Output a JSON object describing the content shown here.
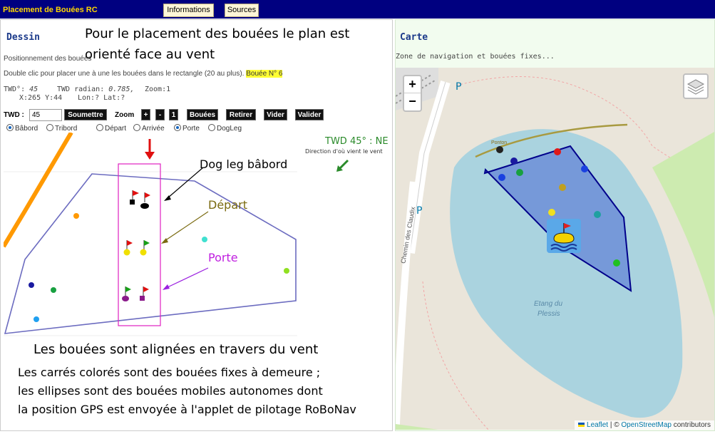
{
  "app": {
    "title": "Placement de Bouées RC"
  },
  "top_buttons": [
    "Informations",
    "Sources"
  ],
  "left": {
    "title": "Dessin",
    "desc1": "Positionnement des bouées ",
    "desc2": "Double clic pour placer une à une les bouées dans le rectangle (20 au plus).",
    "buoy_highlight": "Bouée N° 6",
    "twd_deg_label": "TWD°:",
    "twd_deg_value": "45",
    "twd_rad_label": "TWD radian:",
    "twd_rad_value": "0.785,",
    "zoom_info": "Zoom:1",
    "xy_info": "X:265 Y:44",
    "lonlat_info": "Lon:? Lat:?",
    "twd_label": "TWD :",
    "twd_input_value": "45",
    "submit_label": "Soumettre",
    "zoom_label": "Zoom",
    "zoom_plus": "+",
    "zoom_minus": "-",
    "zoom_value": "1",
    "btn_bouees": "Bouées",
    "btn_retirer": "Retirer",
    "btn_vider": "Vider",
    "btn_valider": "Valider",
    "radios": [
      {
        "label": "Bâbord",
        "checked": true
      },
      {
        "label": "Tribord",
        "checked": false
      },
      {
        "label": "Départ",
        "checked": false
      },
      {
        "label": "Arrivée",
        "checked": false
      },
      {
        "label": "Porte",
        "checked": true
      },
      {
        "label": "DogLeg",
        "checked": false
      }
    ]
  },
  "wind": {
    "title": "TWD 45° : NE",
    "subtitle": "Direction d'où vient le vent"
  },
  "annotations": {
    "header_line1": "Pour le placement des bouées le plan est",
    "header_line2": "orienté face au vent",
    "dogleg": "Dog leg bâbord",
    "depart": "Départ",
    "porte": "Porte",
    "aligned": "Les bouées sont alignées en travers du vent",
    "note1": "Les carrés colorés sont des bouées fixes à demeure ;",
    "note2": "les ellipses sont des bouées mobiles autonomes dont",
    "note3": "la position GPS est envoyée à l'applet de pilotage RoBoNav"
  },
  "right": {
    "title": "Carte",
    "subtitle": "Zone de navigation et bouées fixes...",
    "map": {
      "zoom_in": "+",
      "zoom_out": "−",
      "label_parking1": "P",
      "label_parking2": "P",
      "label_road": "Chemin des Claudix",
      "label_pontoon": "Ponton",
      "label_lake_1": "Etang du",
      "label_lake_2": "Plessis",
      "attribution_leaflet": "Leaflet",
      "attribution_sep": " | © ",
      "attribution_osm": "OpenStreetMap",
      "attribution_contrib": " contributors"
    }
  },
  "colors": {
    "header_bg": "#000080",
    "header_title": "#ffd700",
    "panel_title": "#1b3a8a",
    "lake": "#aad3df",
    "zone_fill": "#4a6fd0",
    "zone_stroke": "#00008b"
  }
}
